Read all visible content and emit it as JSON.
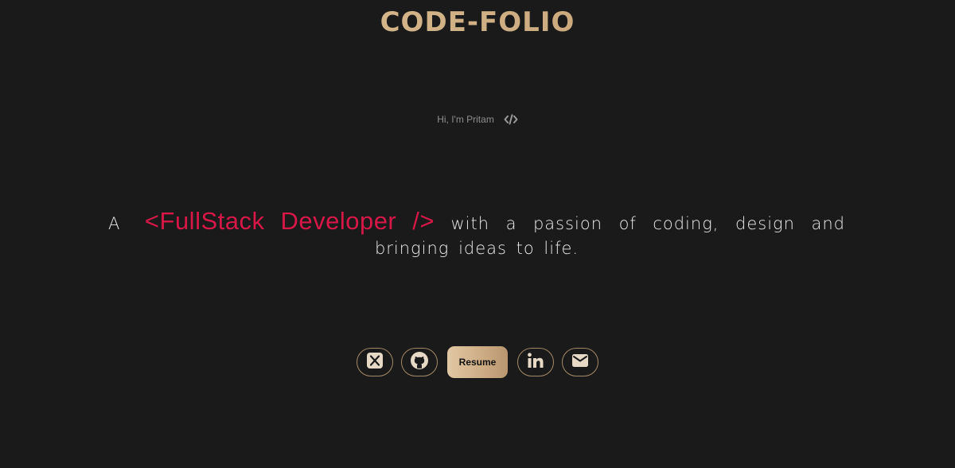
{
  "header": {
    "brand": "CODE-FOLIO"
  },
  "hero": {
    "greeting": "Hi, I'm Pritam",
    "greeting_icon": "code-icon",
    "prefix": "A",
    "role": "<FullStack Developer />",
    "tagline": "with a passion of coding, design and bringing ideas to life."
  },
  "socials": {
    "items": [
      {
        "icon": "x-twitter-icon"
      },
      {
        "icon": "github-icon"
      },
      {
        "icon": "linkedin-icon"
      },
      {
        "icon": "mail-icon"
      }
    ],
    "resume_label": "Resume"
  },
  "colors": {
    "background": "#1a1a1a",
    "accent": "#d61747",
    "gold": "#c9a77b",
    "muted": "#8e8e8e"
  }
}
